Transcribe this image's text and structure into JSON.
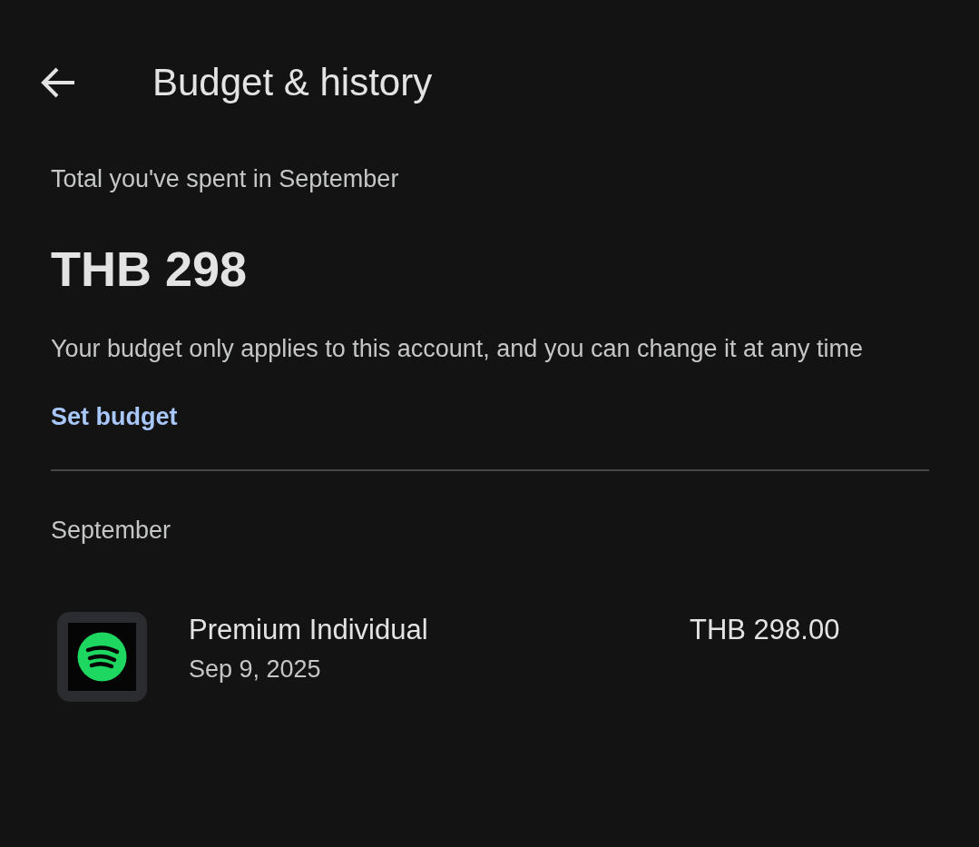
{
  "header": {
    "title": "Budget & history"
  },
  "summary": {
    "label": "Total you've spent in September",
    "amount": "THB 298",
    "note": "Your budget only applies to this account, and you can change it at any time",
    "link": "Set budget"
  },
  "history": {
    "month": "September",
    "items": [
      {
        "name": "Premium Individual",
        "date": "Sep 9, 2025",
        "price": "THB 298.00"
      }
    ]
  }
}
